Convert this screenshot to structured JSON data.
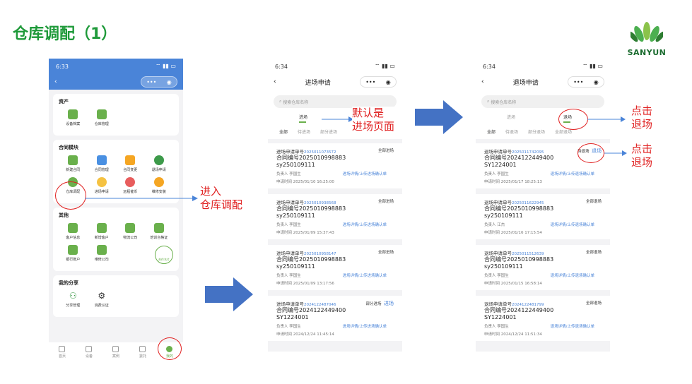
{
  "slide_title": "仓库调配（1）",
  "logo_text": "SANYUN",
  "phone1": {
    "time": "6:33",
    "sections": [
      {
        "title": "资产",
        "items": [
          "设备档案",
          "仓库管理"
        ]
      },
      {
        "title": "合同模块",
        "items": [
          "新建合同",
          "合同管理",
          "合同变更",
          "退场申请",
          "仓库调配",
          "进场申请",
          "远程催币",
          "维修安装"
        ]
      },
      {
        "title": "其他",
        "items": [
          "客户信息",
          "新增客户",
          "物流公司",
          "培训合格证",
          "银行账户",
          "维修公司"
        ]
      },
      {
        "title": "我的分享",
        "items": [
          "分享管理",
          "消费认证"
        ]
      }
    ],
    "tabbar": [
      "首页",
      "设备",
      "案例",
      "委托",
      "我的"
    ],
    "fab_label": "合作名片"
  },
  "phone2": {
    "time": "6:34",
    "title": "进场申请",
    "search_placeholder": "搜索仓库名称",
    "toptab": "进场",
    "tabs": [
      "全部",
      "待进场",
      "部分进场"
    ],
    "cards": [
      {
        "apply_label": "进场申请单号",
        "apply_no": "2025011073572",
        "status": "全部进场",
        "contract": "合同编号2025010998883",
        "code": "sy250109111",
        "owner": "负责人    李国生",
        "link": "进场详情/上传进场确认单",
        "time": "申请时间    2025/01/10 16:25:00"
      },
      {
        "apply_label": "进场申请单号",
        "apply_no": "2025010938568",
        "status": "全部进场",
        "contract": "合同编号2025010998883",
        "code": "sy250109111",
        "owner": "负责人    李国生",
        "link": "进场详情/上传进场确认单",
        "time": "申请时间    2025/01/09 15:37:43"
      },
      {
        "apply_label": "进场申请单号",
        "apply_no": "2025010958147",
        "status": "全部进场",
        "contract": "合同编号2025010998883",
        "code": "sy250109111",
        "owner": "负责人    李国生",
        "link": "进场详情/上传进场确认单",
        "time": "申请时间    2025/01/09 13:17:56"
      },
      {
        "apply_label": "进场申请单号",
        "apply_no": "2024122487046",
        "status": "部分进场",
        "extra": "进场",
        "contract": "合同编号2024122449400",
        "code": "SY1224001",
        "owner": "负责人    李国生",
        "link": "进场详情/上传进场确认单",
        "time": "申请时间    2024/12/24 11:45:14"
      }
    ]
  },
  "phone3": {
    "time": "6:34",
    "title": "退场申请",
    "search_placeholder": "搜索仓库名称",
    "toptabs": [
      "进场",
      "退场"
    ],
    "tabs": [
      "全部",
      "待退场",
      "部分退场",
      "全部退场"
    ],
    "cards": [
      {
        "apply_label": "退场申请单号",
        "apply_no": "2025011742095",
        "status": "待退场",
        "extra": "退场",
        "contract": "合同编号2024122449400",
        "code": "SY1224001",
        "owner": "负责人    李国生",
        "link": "退场详情/上传退场确认单",
        "time": "申请时间    2025/01/17 18:25:13"
      },
      {
        "apply_label": "退场申请单号",
        "apply_no": "2025011622945",
        "status": "全部退场",
        "contract": "合同编号2025010998883",
        "code": "sy250109111",
        "owner": "负责人    江杰",
        "link": "退场详情/上传退场确认单",
        "time": "申请时间    2025/01/16 17:15:54"
      },
      {
        "apply_label": "退场申请单号",
        "apply_no": "2025011512639",
        "status": "全部退场",
        "contract": "合同编号2025010998883",
        "code": "sy250109111",
        "owner": "负责人    李国生",
        "link": "退场详情/上传退场确认单",
        "time": "申请时间    2025/01/15 16:58:14"
      },
      {
        "apply_label": "退场申请单号",
        "apply_no": "2024122481799",
        "status": "全部退场",
        "contract": "合同编号2024122449400",
        "code": "SY1224001",
        "owner": "负责人    李国生",
        "link": "退场详情/上传退场确认单",
        "time": "申请时间    2024/12/24 11:51:34"
      }
    ]
  },
  "annotations": {
    "enter_line1": "进入",
    "enter_line2": "仓库调配",
    "default_line1": "默认是",
    "default_line2": "进场页面",
    "click1_line1": "点击",
    "click1_line2": "退场",
    "click2_line1": "点击",
    "click2_line2": "退场"
  }
}
